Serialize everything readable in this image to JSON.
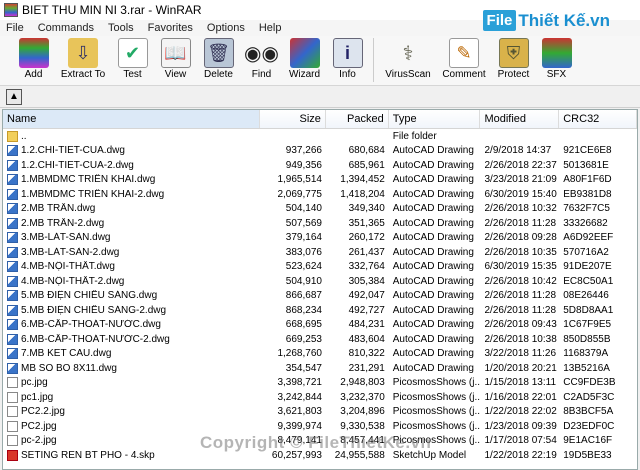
{
  "window": {
    "title": "BIET THU MIN NI 3.rar - WinRAR"
  },
  "watermark": {
    "box": "File",
    "text": "Thiết Kế.vn",
    "copyright": "Copyright © FileThietKe.vn"
  },
  "menu": [
    "File",
    "Commands",
    "Tools",
    "Favorites",
    "Options",
    "Help"
  ],
  "toolbar": [
    {
      "label": "Add",
      "icon": "add-archive-icon"
    },
    {
      "label": "Extract To",
      "icon": "extract-folder-icon"
    },
    {
      "label": "Test",
      "icon": "test-checklist-icon"
    },
    {
      "label": "View",
      "icon": "view-book-icon"
    },
    {
      "label": "Delete",
      "icon": "delete-trash-icon"
    },
    {
      "label": "Find",
      "icon": "find-binoculars-icon"
    },
    {
      "label": "Wizard",
      "icon": "wizard-wand-icon"
    },
    {
      "label": "Info",
      "icon": "info-icon"
    },
    {
      "label": "VirusScan",
      "icon": "virus-scan-icon"
    },
    {
      "label": "Comment",
      "icon": "comment-pen-icon"
    },
    {
      "label": "Protect",
      "icon": "protect-shield-icon"
    },
    {
      "label": "SFX",
      "icon": "sfx-icon"
    }
  ],
  "columns": {
    "name": "Name",
    "size": "Size",
    "packed": "Packed",
    "type": "Type",
    "modified": "Modified",
    "crc": "CRC32"
  },
  "files": [
    {
      "name": "..",
      "size": "",
      "packed": "",
      "type": "File folder",
      "modified": "",
      "crc": "",
      "icon": "folder"
    },
    {
      "name": "1.2.CHI-TIET-CUA.dwg",
      "size": "937,266",
      "packed": "680,684",
      "type": "AutoCAD Drawing",
      "modified": "2/9/2018 14:37",
      "crc": "921CE6E8",
      "icon": "dwg"
    },
    {
      "name": "1.2.CHI-TIET-CUA-2.dwg",
      "size": "949,356",
      "packed": "685,961",
      "type": "AutoCAD Drawing",
      "modified": "2/26/2018 22:37",
      "crc": "5013681E",
      "icon": "dwg"
    },
    {
      "name": "1.MBMDMC TRIỂN KHAI.dwg",
      "size": "1,965,514",
      "packed": "1,394,452",
      "type": "AutoCAD Drawing",
      "modified": "3/23/2018 21:09",
      "crc": "A80F1F6D",
      "icon": "dwg"
    },
    {
      "name": "1.MBMDMC TRIỂN KHAI-2.dwg",
      "size": "2,069,775",
      "packed": "1,418,204",
      "type": "AutoCAD Drawing",
      "modified": "6/30/2019 15:40",
      "crc": "EB9381D8",
      "icon": "dwg"
    },
    {
      "name": "2.MB TRẦN.dwg",
      "size": "504,140",
      "packed": "349,340",
      "type": "AutoCAD Drawing",
      "modified": "2/26/2018 10:32",
      "crc": "7632F7C5",
      "icon": "dwg"
    },
    {
      "name": "2.MB TRẦN-2.dwg",
      "size": "507,569",
      "packed": "351,365",
      "type": "AutoCAD Drawing",
      "modified": "2/26/2018 11:28",
      "crc": "33326682",
      "icon": "dwg"
    },
    {
      "name": "3.MB-LÁT-SÀN.dwg",
      "size": "379,164",
      "packed": "260,172",
      "type": "AutoCAD Drawing",
      "modified": "2/26/2018 09:28",
      "crc": "A6D92EEF",
      "icon": "dwg"
    },
    {
      "name": "3.MB-LÁT-SÀN-2.dwg",
      "size": "383,076",
      "packed": "261,437",
      "type": "AutoCAD Drawing",
      "modified": "2/26/2018 10:35",
      "crc": "570716A2",
      "icon": "dwg"
    },
    {
      "name": "4.MB-NỘI-THẤT.dwg",
      "size": "523,624",
      "packed": "332,764",
      "type": "AutoCAD Drawing",
      "modified": "6/30/2019 15:35",
      "crc": "91DE207E",
      "icon": "dwg"
    },
    {
      "name": "4.MB-NỘI-THẤT-2.dwg",
      "size": "504,910",
      "packed": "305,384",
      "type": "AutoCAD Drawing",
      "modified": "2/26/2018 10:42",
      "crc": "EC8C50A1",
      "icon": "dwg"
    },
    {
      "name": "5.MB ĐIỆN CHIẾU SÁNG.dwg",
      "size": "866,687",
      "packed": "492,047",
      "type": "AutoCAD Drawing",
      "modified": "2/26/2018 11:28",
      "crc": "08E26446",
      "icon": "dwg"
    },
    {
      "name": "5.MB ĐIỆN CHIẾU SÁNG-2.dwg",
      "size": "868,234",
      "packed": "492,727",
      "type": "AutoCAD Drawing",
      "modified": "2/26/2018 11:28",
      "crc": "5D8D8AA1",
      "icon": "dwg"
    },
    {
      "name": "6.MB-CẤP-THOÁT-NƯỚC.dwg",
      "size": "668,695",
      "packed": "484,231",
      "type": "AutoCAD Drawing",
      "modified": "2/26/2018 09:43",
      "crc": "1C67F9E5",
      "icon": "dwg"
    },
    {
      "name": "6.MB-CẤP-THOÁT-NƯỚC-2.dwg",
      "size": "669,253",
      "packed": "483,604",
      "type": "AutoCAD Drawing",
      "modified": "2/26/2018 10:38",
      "crc": "850D855B",
      "icon": "dwg"
    },
    {
      "name": "7.MB KET CAU.dwg",
      "size": "1,268,760",
      "packed": "810,322",
      "type": "AutoCAD Drawing",
      "modified": "3/22/2018 11:26",
      "crc": "1168379A",
      "icon": "dwg"
    },
    {
      "name": "MB SO BO 8X11.dwg",
      "size": "354,547",
      "packed": "231,291",
      "type": "AutoCAD Drawing",
      "modified": "1/20/2018 20:21",
      "crc": "13B5216A",
      "icon": "dwg"
    },
    {
      "name": "pc.jpg",
      "size": "3,398,721",
      "packed": "2,948,803",
      "type": "PicosmosShows (j...",
      "modified": "1/15/2018 13:11",
      "crc": "CC9FDE3B",
      "icon": "jpg"
    },
    {
      "name": "pc1.jpg",
      "size": "3,242,844",
      "packed": "3,232,370",
      "type": "PicosmosShows (j...",
      "modified": "1/16/2018 22:01",
      "crc": "C2AD5F3C",
      "icon": "jpg"
    },
    {
      "name": "PC2.2.jpg",
      "size": "3,621,803",
      "packed": "3,204,896",
      "type": "PicosmosShows (j...",
      "modified": "1/22/2018 22:02",
      "crc": "8B3BCF5A",
      "icon": "jpg"
    },
    {
      "name": "PC2.jpg",
      "size": "9,399,974",
      "packed": "9,330,538",
      "type": "PicosmosShows (j...",
      "modified": "1/23/2018 09:39",
      "crc": "D23EDF0C",
      "icon": "jpg"
    },
    {
      "name": "pc-2.jpg",
      "size": "8,479,141",
      "packed": "8,457,441",
      "type": "PicosmosShows (j...",
      "modified": "1/17/2018 07:54",
      "crc": "9E1AC16F",
      "icon": "jpg"
    },
    {
      "name": "SETING REN BT PHO - 4.skp",
      "size": "60,257,993",
      "packed": "24,955,588",
      "type": "SketchUp Model",
      "modified": "1/22/2018 22:19",
      "crc": "19D5BE33",
      "icon": "skp"
    }
  ]
}
